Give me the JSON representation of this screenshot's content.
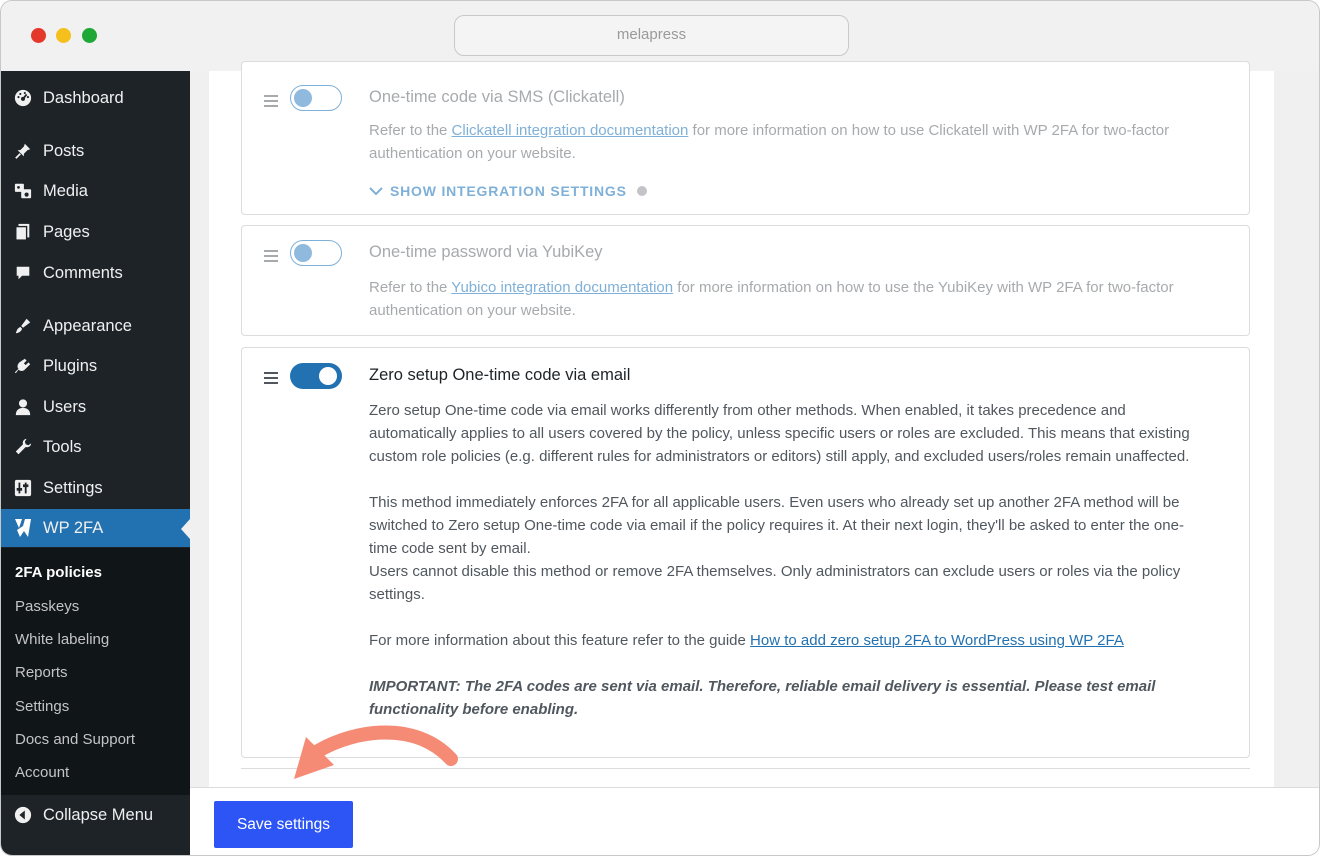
{
  "browser": {
    "url": "melapress"
  },
  "sidebar": {
    "items": [
      {
        "label": "Dashboard",
        "icon": "dashboard-icon"
      },
      {
        "label": "Posts",
        "icon": "pin-icon"
      },
      {
        "label": "Media",
        "icon": "media-icon"
      },
      {
        "label": "Pages",
        "icon": "pages-icon"
      },
      {
        "label": "Comments",
        "icon": "comments-icon"
      },
      {
        "label": "Appearance",
        "icon": "brush-icon"
      },
      {
        "label": "Plugins",
        "icon": "plug-icon"
      },
      {
        "label": "Users",
        "icon": "user-icon"
      },
      {
        "label": "Tools",
        "icon": "wrench-icon"
      },
      {
        "label": "Settings",
        "icon": "sliders-icon"
      },
      {
        "label": "WP 2FA",
        "icon": "wp2fa-logo-icon"
      }
    ],
    "submenu": [
      "2FA policies",
      "Passkeys",
      "White labeling",
      "Reports",
      "Settings",
      "Docs and Support",
      "Account"
    ],
    "collapse_label": "Collapse Menu"
  },
  "methods": {
    "sms": {
      "title": "One-time code via SMS (Clickatell)",
      "desc_pre": "Refer to the ",
      "link": "Clickatell integration documentation",
      "desc_post": " for more information on how to use Clickatell with WP 2FA for two-factor authentication on your website.",
      "show_settings": "SHOW INTEGRATION SETTINGS"
    },
    "yubikey": {
      "title": "One-time password via YubiKey",
      "desc_pre": "Refer to the ",
      "link": "Yubico integration documentation",
      "desc_post": " for more information on how to use the YubiKey with WP 2FA for two-factor authentication on your website."
    },
    "email": {
      "title": "Zero setup One-time code via email",
      "para1": "Zero setup One-time code via email works differently from other methods. When enabled, it takes precedence and automatically applies to all users covered by the policy, unless specific users or roles are excluded. This means that existing custom role policies (e.g. different rules for administrators or editors) still apply, and excluded users/roles remain unaffected.",
      "para2": "This method immediately enforces 2FA for all applicable users. Even users who already set up another 2FA method will be switched to Zero setup One-time code via email if the policy requires it. At their next login, they'll be asked to enter the one-time code sent by email.",
      "para3": "Users cannot disable this method or remove 2FA themselves. Only administrators can exclude users or roles via the policy settings.",
      "para4_pre": "For more information about this feature refer to the guide ",
      "para4_link": "How to add zero setup 2FA to WordPress using WP 2FA",
      "important": "IMPORTANT: The 2FA codes are sent via email. Therefore, reliable email delivery is essential. Please test email functionality before enabling."
    }
  },
  "footer": {
    "save_label": "Save settings"
  },
  "colors": {
    "accent": "#2271b1",
    "save_button": "#2d55f5",
    "annotation_arrow": "#f58a75"
  }
}
